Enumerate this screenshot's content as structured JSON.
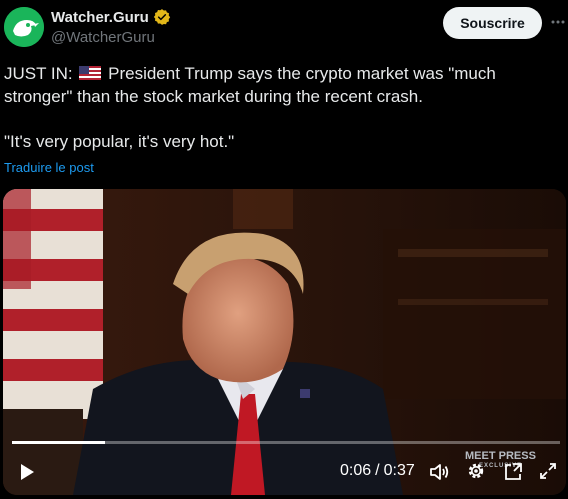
{
  "author": {
    "display_name": "Watcher.Guru",
    "handle": "@WatcherGuru",
    "verified_color": "#e2b719",
    "avatar_color": "#1ab55a"
  },
  "header": {
    "subscribe_label": "Souscrire",
    "more_icon": "more-dots-icon"
  },
  "tweet": {
    "prefix": "JUST IN:",
    "flag_icon": "us-flag-icon",
    "line1_rest": "President Trump says the crypto market was \"much stronger\" than the stock market during the recent crash.",
    "quote": "\"It's very popular, it's very hot.\"",
    "translate_label": "Traduire le post"
  },
  "video": {
    "current_time": "0:06",
    "separator": "/",
    "duration": "0:37",
    "progress_fraction": 0.17,
    "watermark_title": "MEET PRESS",
    "watermark_sub": "EXCLUSIVE",
    "controls": [
      "play-icon",
      "volume-icon",
      "settings-gear-icon",
      "pip-icon",
      "fullscreen-icon"
    ]
  },
  "colors": {
    "background": "#000000",
    "text": "#e7e9ea",
    "muted": "#71767b",
    "link": "#1d9bf0"
  }
}
